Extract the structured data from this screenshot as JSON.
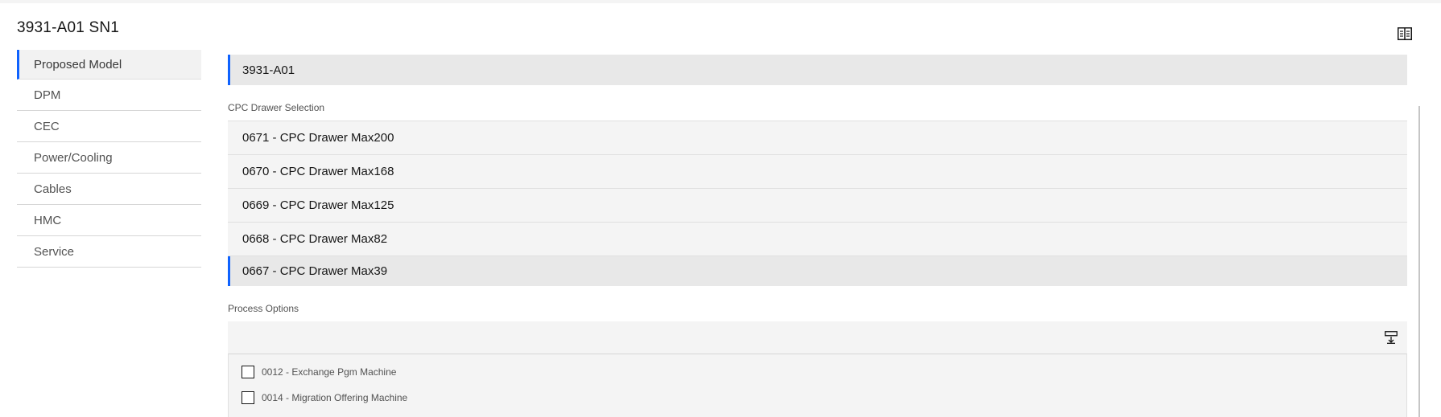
{
  "header": {
    "title": "3931-A01 SN1",
    "icon": "table-view-icon"
  },
  "sidebar": {
    "items": [
      {
        "label": "Proposed Model",
        "active": true
      },
      {
        "label": "DPM"
      },
      {
        "label": "CEC"
      },
      {
        "label": "Power/Cooling"
      },
      {
        "label": "Cables"
      },
      {
        "label": "HMC"
      },
      {
        "label": "Service"
      }
    ]
  },
  "main": {
    "model": "3931-A01",
    "drawer_section_label": "CPC Drawer Selection",
    "drawers": [
      {
        "label": "0671 - CPC Drawer Max200"
      },
      {
        "label": "0670 - CPC Drawer Max168"
      },
      {
        "label": "0669 - CPC Drawer Max125"
      },
      {
        "label": "0668 - CPC Drawer Max82"
      },
      {
        "label": "0667 - CPC Drawer Max39",
        "selected": true
      }
    ],
    "process_section_label": "Process Options",
    "process_toolbar_icon": "download-icon",
    "process_options": [
      {
        "label": "0012 - Exchange Pgm Machine",
        "checked": false
      },
      {
        "label": "0014 - Migration Offering Machine",
        "checked": false
      }
    ]
  },
  "colors": {
    "accent": "#0f62fe",
    "panel_bg": "#ffffff",
    "row_bg": "#f4f4f4",
    "selected_bg": "#e8e8e8"
  }
}
